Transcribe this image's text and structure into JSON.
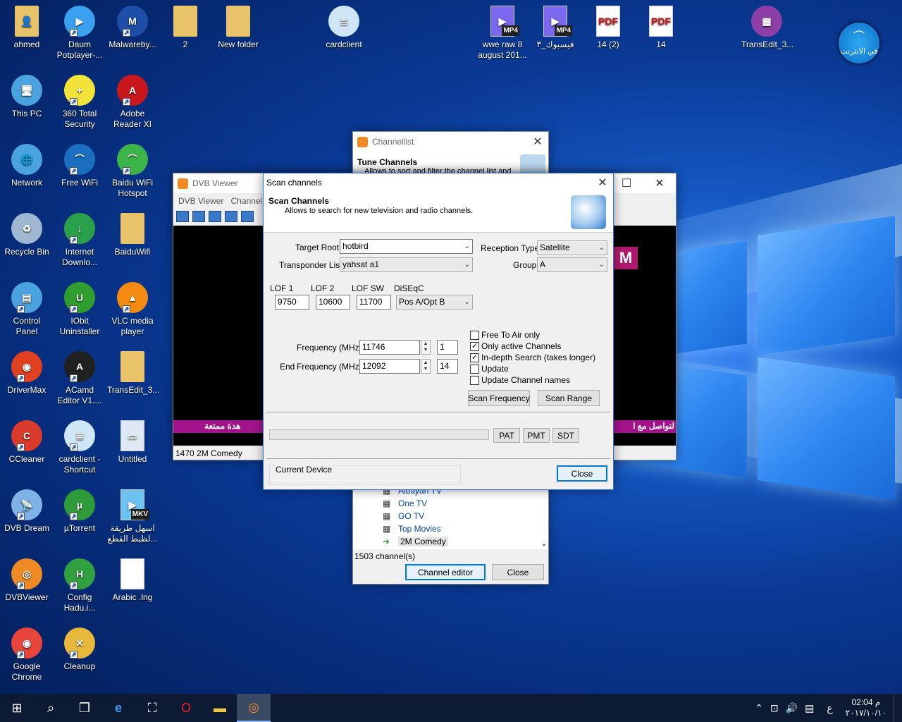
{
  "desktop_icons": [
    {
      "label": "ahmed",
      "icon": "user-folder-icon",
      "color": "#e8c36a",
      "glyph": "👤",
      "shortcut": false
    },
    {
      "label": "Daum Potplayer-...",
      "icon": "potplayer-icon",
      "color": "#3aa0f0",
      "glyph": "▶",
      "shortcut": true
    },
    {
      "label": "Malwareby...",
      "icon": "malwarebytes-icon",
      "color": "#1e4fa8",
      "glyph": "M",
      "shortcut": true
    },
    {
      "label": "2",
      "icon": "folder-icon",
      "color": "#e8c36a",
      "glyph": "",
      "shortcut": false
    },
    {
      "label": "New folder",
      "icon": "folder-icon",
      "color": "#e8c36a",
      "glyph": "",
      "shortcut": false
    },
    {
      "label": "cardclient",
      "icon": "notepad-icon",
      "color": "#cfe6f7",
      "glyph": "≣",
      "shortcut": false
    },
    {
      "label": "wwe raw 8 august 201...",
      "icon": "mp4-file-icon",
      "color": "#7b68ee",
      "glyph": "▶",
      "shortcut": false
    },
    {
      "label": "فيسبوك_٣",
      "icon": "mp4-file-icon",
      "color": "#7b68ee",
      "glyph": "▶",
      "shortcut": false
    },
    {
      "label": "14 (2)",
      "icon": "pdf-file-icon",
      "color": "#ffffff",
      "glyph": "PDF",
      "shortcut": false
    },
    {
      "label": "14",
      "icon": "pdf-file-icon",
      "color": "#ffffff",
      "glyph": "PDF",
      "shortcut": false
    },
    {
      "label": "TransEdit_3...",
      "icon": "winrar-archive-icon",
      "color": "#8e3fa6",
      "glyph": "▦",
      "shortcut": false
    },
    {
      "label": "This PC",
      "icon": "this-pc-icon",
      "color": "#4aa3df",
      "glyph": "🖥",
      "shortcut": false
    },
    {
      "label": "360 Total Security",
      "icon": "360-security-icon",
      "color": "#f1e33a",
      "glyph": "+",
      "shortcut": true
    },
    {
      "label": "Adobe Reader XI",
      "icon": "adobe-reader-icon",
      "color": "#c8181e",
      "glyph": "A",
      "shortcut": true
    },
    {
      "label": "Network",
      "icon": "network-icon",
      "color": "#4aa3df",
      "glyph": "🌐",
      "shortcut": false
    },
    {
      "label": "Free WiFi",
      "icon": "wifi-icon",
      "color": "#1a6fc0",
      "glyph": "⌒",
      "shortcut": true
    },
    {
      "label": "Baidu WiFi Hotspot",
      "icon": "baidu-wifi-icon",
      "color": "#3bb54a",
      "glyph": "⌒",
      "shortcut": true
    },
    {
      "label": "Recycle Bin",
      "icon": "recycle-bin-icon",
      "color": "#9fb7d0",
      "glyph": "♻",
      "shortcut": false
    },
    {
      "label": "Internet Downlo...",
      "icon": "idm-icon",
      "color": "#2aa04a",
      "glyph": "↓",
      "shortcut": true
    },
    {
      "label": "BaiduWifi",
      "icon": "folder-icon",
      "color": "#e8c36a",
      "glyph": "",
      "shortcut": false
    },
    {
      "label": "Control Panel",
      "icon": "control-panel-icon",
      "color": "#4aa3df",
      "glyph": "▤",
      "shortcut": true
    },
    {
      "label": "IObit Uninstaller",
      "icon": "iobit-icon",
      "color": "#2f9e2f",
      "glyph": "U",
      "shortcut": true
    },
    {
      "label": "VLC media player",
      "icon": "vlc-icon",
      "color": "#f38b10",
      "glyph": "▲",
      "shortcut": true
    },
    {
      "label": "DriverMax",
      "icon": "drivermax-icon",
      "color": "#e04020",
      "glyph": "◉",
      "shortcut": true
    },
    {
      "label": "ACamd Editor V1....",
      "icon": "acamd-icon",
      "color": "#202020",
      "glyph": "A",
      "shortcut": true
    },
    {
      "label": "TransEdit_3...",
      "icon": "folder-icon",
      "color": "#e8c36a",
      "glyph": "",
      "shortcut": false
    },
    {
      "label": "CCleaner",
      "icon": "ccleaner-icon",
      "color": "#d93a2b",
      "glyph": "C",
      "shortcut": true
    },
    {
      "label": "cardclient - Shortcut",
      "icon": "notepad-icon",
      "color": "#cfe6f7",
      "glyph": "≣",
      "shortcut": true
    },
    {
      "label": "Untitled",
      "icon": "image-file-icon",
      "color": "#dfe9f5",
      "glyph": "▭",
      "shortcut": false
    },
    {
      "label": "DVB Dream",
      "icon": "dvb-dream-icon",
      "color": "#7fb3e8",
      "glyph": "📡",
      "shortcut": true
    },
    {
      "label": "µTorrent",
      "icon": "utorrent-icon",
      "color": "#2e9b3a",
      "glyph": "µ",
      "shortcut": true
    },
    {
      "label": "اسهل طريقة لظبط القطع...",
      "icon": "mkv-file-icon",
      "color": "#6cc3f0",
      "glyph": "▶",
      "shortcut": false
    },
    {
      "label": "DVBViewer",
      "icon": "dvbviewer-icon",
      "color": "#f08a24",
      "glyph": "◎",
      "shortcut": true
    },
    {
      "label": "Config Hadu.i...",
      "icon": "config-icon",
      "color": "#30a040",
      "glyph": "H",
      "shortcut": true
    },
    {
      "label": "Arabic .lng",
      "icon": "blank-file-icon",
      "color": "#ffffff",
      "glyph": "",
      "shortcut": false
    },
    {
      "label": "Google Chrome",
      "icon": "chrome-icon",
      "color": "#e8453c",
      "glyph": "◉",
      "shortcut": true
    },
    {
      "label": "Cleanup",
      "icon": "cleanup-broom-icon",
      "color": "#e8b83a",
      "glyph": "✕",
      "shortcut": true
    }
  ],
  "badges": {
    "mp4": "MP4",
    "mkv": "MKV"
  },
  "network_widget": {
    "label": "في الانترنت"
  },
  "channellist": {
    "title": "Channellist",
    "header_title": "Tune Channels",
    "header_desc": "Allows to sort and filter the channel list and",
    "channels": [
      "Albayan TV",
      "One TV",
      "GO TV",
      "Top Movies",
      "2M Comedy"
    ],
    "selected": "2M Comedy",
    "count": "1503 channel(s)",
    "editor_button": "Channel editor",
    "close_button": "Close"
  },
  "dvbviewer": {
    "title": "DVB Viewer",
    "menu": [
      "DVB Viewer",
      "Channel"
    ],
    "status": "1470 2M Comedy",
    "ticker_left": "هدة ممتعة",
    "ticker_right": "لتواصل مع ا",
    "channel_logo": "M"
  },
  "scan": {
    "title": "Scan channels",
    "header_title": "Scan Channels",
    "header_desc": "Allows to search for new television and radio channels.",
    "target_root_label": "Target Root",
    "target_root": "hotbird",
    "transponder_label": "Transponder List",
    "transponder": "yahsat  a1",
    "reception_label": "Reception Type",
    "reception": "Satellite",
    "group_label": "Group",
    "group": "A",
    "lof1_label": "LOF 1",
    "lof1": "9750",
    "lof2_label": "LOF 2",
    "lof2": "10600",
    "lofsw_label": "LOF SW",
    "lofsw": "11700",
    "diseqc_label": "DiSEqC",
    "diseqc": "Pos A/Opt B",
    "freq_label": "Frequency (MHz)",
    "freq": "11746",
    "freq_idx": "1",
    "end_label": "End",
    "end_freq_label": "Frequency (MHz)",
    "end_freq": "12092",
    "end_idx": "14",
    "checks": [
      {
        "label": "Free To Air only",
        "checked": false
      },
      {
        "label": "Only active Channels",
        "checked": true
      },
      {
        "label": "In-depth Search (takes longer)",
        "checked": true
      },
      {
        "label": "Update",
        "checked": false
      },
      {
        "label": "Update Channel names",
        "checked": false
      }
    ],
    "scan_freq_btn": "Scan Frequency",
    "scan_range_btn": "Scan Range",
    "pat": "PAT",
    "pmt": "PMT",
    "sdt": "SDT",
    "current_device": "Current Device",
    "close": "Close"
  },
  "taskbar": {
    "time": "02:04 م",
    "date": "٢٠١٧/١٠/١٠",
    "lang": "ع"
  }
}
